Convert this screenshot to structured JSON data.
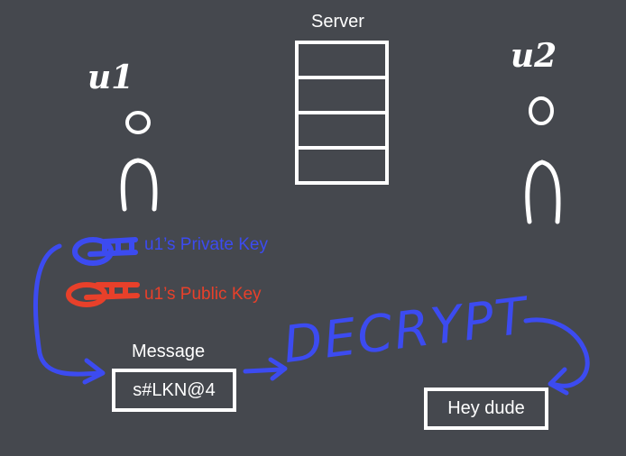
{
  "server": {
    "label": "Server",
    "rows": 4
  },
  "user1": {
    "name": "u1"
  },
  "user2": {
    "name": "u2"
  },
  "keys": {
    "private": {
      "label": "u1’s Private Key",
      "color": "#3c4bf0"
    },
    "public": {
      "label": "u1’s Public Key",
      "color": "#e8402a"
    }
  },
  "message": {
    "title": "Message",
    "ciphertext": "s#LKN@4"
  },
  "action": {
    "label": "DECRYPT",
    "color": "#3c4bf0"
  },
  "result": {
    "plaintext": "Hey dude"
  }
}
